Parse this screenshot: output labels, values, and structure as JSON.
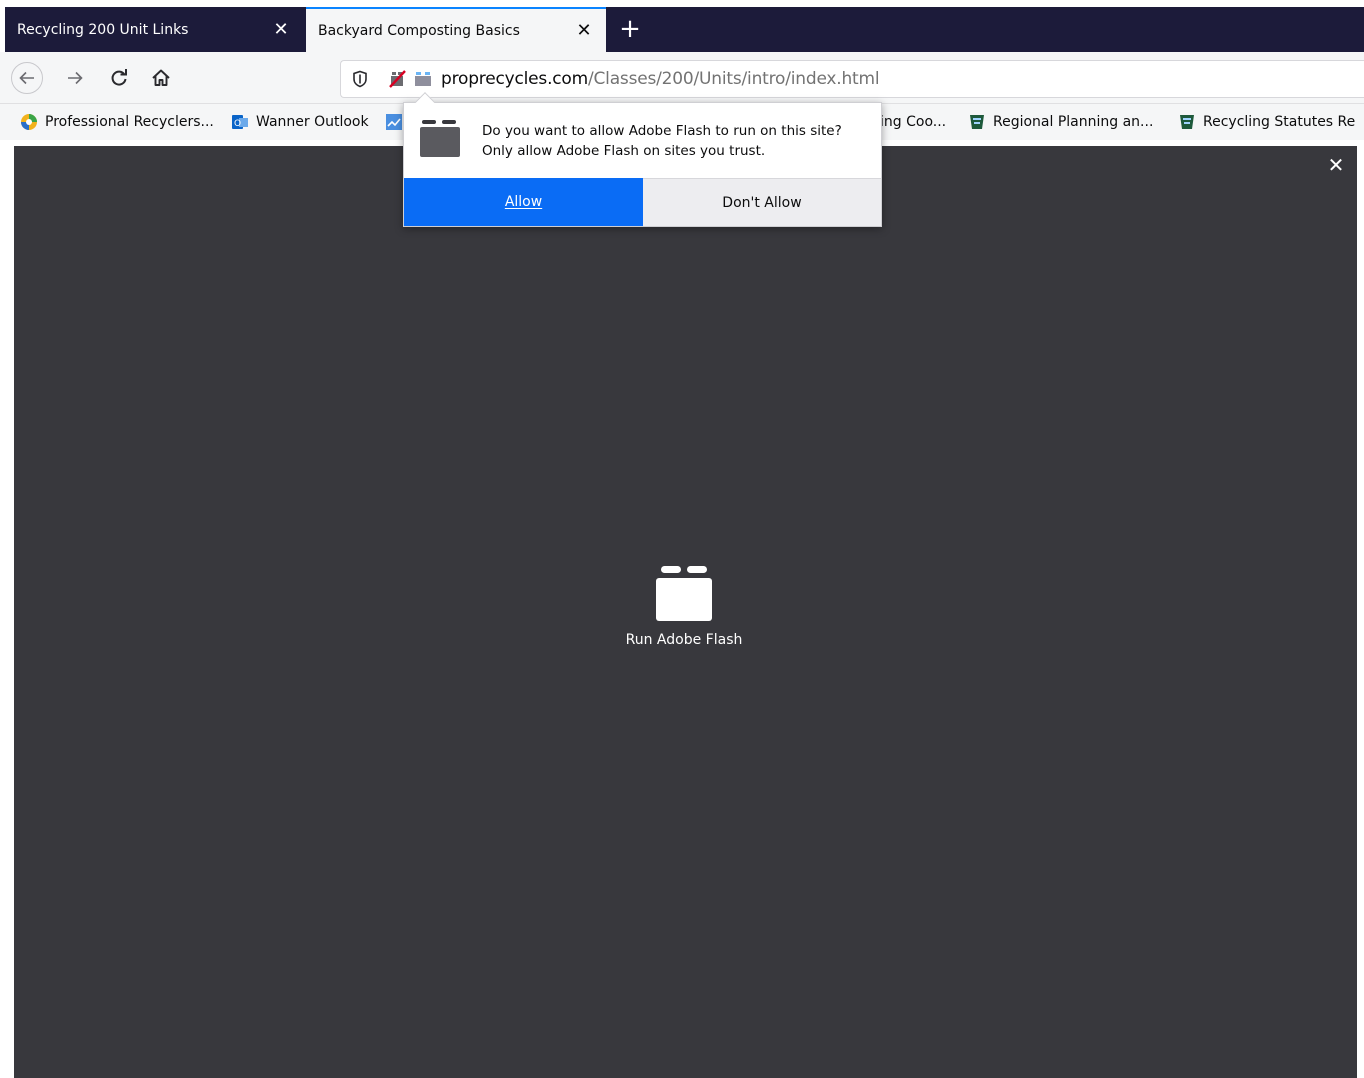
{
  "tabs": [
    {
      "label": "Recycling 200 Unit Links",
      "active": false
    },
    {
      "label": "Backyard Composting Basics",
      "active": true
    }
  ],
  "tab_close_glyph": "✕",
  "newtab_glyph": "+",
  "url": {
    "domain": "proprecycles.com",
    "path": "/Classes/200/Units/intro/index.html"
  },
  "bookmarks": [
    {
      "label": "Professional Recyclers...",
      "icon": "globe-colored-icon"
    },
    {
      "label": "Wanner Outlook",
      "icon": "outlook-icon"
    },
    {
      "label": "",
      "icon": "chart-icon"
    },
    {
      "label": "ing Coo...",
      "icon": ""
    },
    {
      "label": "Regional Planning an...",
      "icon": "state-seal-icon"
    },
    {
      "label": "Recycling Statutes Re",
      "icon": "state-seal-icon"
    }
  ],
  "popup": {
    "line1": "Do you want to allow Adobe Flash to run on this site?",
    "line2": "Only allow Adobe Flash on sites you trust.",
    "allow_label": "Allow",
    "deny_label": "Don't Allow"
  },
  "content": {
    "run_flash_label": "Run Adobe Flash",
    "close_glyph": "✕"
  },
  "colors": {
    "tabstrip": "#1c1b3a",
    "accent": "#0a6cf5",
    "content_bg": "#38383d"
  }
}
